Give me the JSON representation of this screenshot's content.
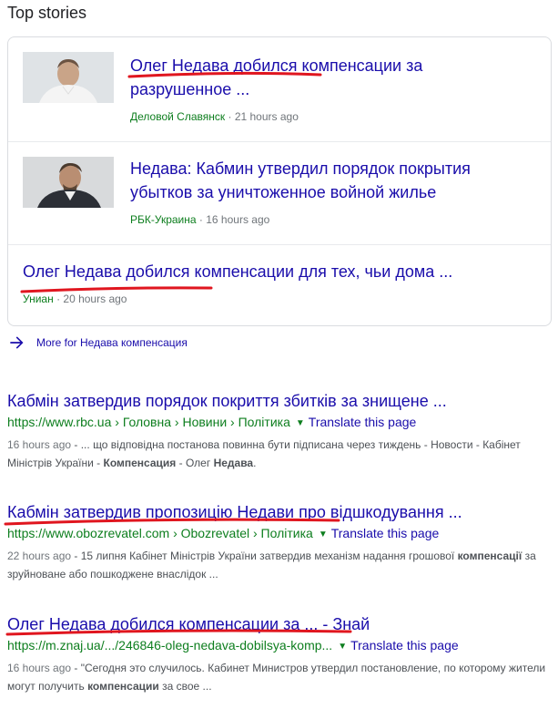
{
  "top_stories": {
    "title": "Top stories",
    "items": [
      {
        "title": "Олег Недава добился компенсации за разрушенное ...",
        "source": "Деловой Славянск",
        "time": "21 hours ago"
      },
      {
        "title": "Недава: Кабмин утвердил порядок покрытия убытков за уничтоженное войной жилье",
        "source": "РБК-Украина",
        "time": "16 hours ago"
      },
      {
        "title": "Олег Недава добился компенсации для тех, чьи дома ...",
        "source": "Униан",
        "time": "20 hours ago"
      }
    ],
    "separator": "·"
  },
  "more_link": {
    "label": "More for Недава компенсация",
    "icon": "arrow-right-icon"
  },
  "results": [
    {
      "title": "Кабмін затвердив порядок покриття збитків за знищене ...",
      "url": "https://www.rbc.ua › Головна › Новини › Політика",
      "translate": "Translate this page",
      "date": "16 hours ago",
      "snippet_a": " - ... що відповідна постанова повинна бути підписана через тиждень - Новости - Кабінет Міністрів України - ",
      "snippet_b1": "Компенсация",
      "snippet_c": " - Олег ",
      "snippet_b2": "Недава",
      "snippet_d": "."
    },
    {
      "title": "Кабмін затвердив пропозицію Недави про відшкодування ...",
      "url": "https://www.obozrevatel.com › Obozrevatel › Політика",
      "translate": "Translate this page",
      "date": "22 hours ago",
      "snippet_a": " - 15 липня Кабінет Міністрів України затвердив механізм надання грошової ",
      "snippet_b1": "компенсації",
      "snippet_c": " за зруйноване або пошкоджене внаслідок ...",
      "snippet_b2": "",
      "snippet_d": ""
    },
    {
      "title": "Олег Недава добился компенсации за ... - Знай",
      "url": "https://m.znaj.ua/.../246846-oleg-nedava-dobilsya-komp...",
      "translate": "Translate this page",
      "date": "16 hours ago",
      "snippet_a": " - \"Сегодня это случилось. Кабинет Министров утвердил постановление, по которому жители могут получить ",
      "snippet_b1": "компенсации",
      "snippet_c": " за свое ...",
      "snippet_b2": "",
      "snippet_d": ""
    }
  ],
  "colors": {
    "link": "#1a0dab",
    "url_green": "#0d7e1e",
    "meta_gray": "#70757a",
    "annotation_red": "#e0161f"
  }
}
